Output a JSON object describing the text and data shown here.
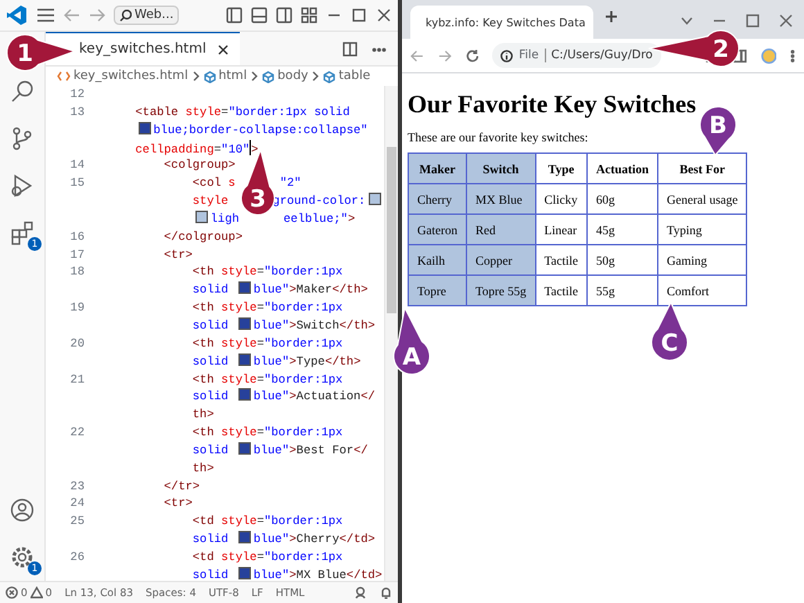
{
  "editor": {
    "title_bar": {
      "search": "Web..."
    },
    "activity_badges": {
      "extensions": "1",
      "settings": "1"
    },
    "tab": {
      "label": "key_switches.html",
      "selected": true
    },
    "breadcrumb": [
      {
        "kind": "file",
        "label": "key_switches.html"
      },
      {
        "kind": "element",
        "label": "html"
      },
      {
        "kind": "element",
        "label": "body"
      },
      {
        "kind": "element",
        "label": "table"
      }
    ],
    "code_lines": [
      {
        "number": "12"
      },
      {
        "number": "13",
        "rows": [
          [
            {
              "kind": "tag",
              "text": "<table"
            },
            {
              "kind": "attr",
              "text": " style"
            },
            {
              "kind": "text",
              "text": "="
            },
            {
              "kind": "string",
              "text": "\"border:1px solid"
            }
          ],
          [
            {
              "kind": "swatch",
              "color": "#27419b"
            },
            {
              "kind": "string",
              "text": "blue;border-collapse:collapse\""
            }
          ],
          [
            {
              "kind": "attr",
              "text": "cellpadding"
            },
            {
              "kind": "text",
              "text": "="
            },
            {
              "kind": "string",
              "text": "\"10\""
            },
            {
              "kind": "cursor"
            },
            {
              "kind": "tag",
              "text": ">"
            }
          ]
        ],
        "children": [
          {
            "number": "14",
            "rows": [
              [
                {
                  "kind": "tag",
                  "text": "<colgroup>"
                }
              ]
            ],
            "children": [
              {
                "number": "15",
                "rows": [
                  [
                    {
                      "kind": "tag",
                      "text": "<col"
                    },
                    {
                      "kind": "attr",
                      "text": " s"
                    },
                    {
                      "kind": "covered"
                    },
                    {
                      "kind": "string",
                      "text": "\"2\""
                    }
                  ],
                  [
                    {
                      "kind": "attr",
                      "text": "style"
                    },
                    {
                      "kind": "covered"
                    },
                    {
                      "kind": "string",
                      "text": "ground-color:"
                    },
                    {
                      "kind": "swatch",
                      "color": "#b0c4de"
                    }
                  ],
                  [
                    {
                      "kind": "swatch",
                      "color": "#b0c4de"
                    },
                    {
                      "kind": "string",
                      "text": "ligh"
                    },
                    {
                      "kind": "covered"
                    },
                    {
                      "kind": "string",
                      "text": "eelblue;\""
                    },
                    {
                      "kind": "tag",
                      "text": ">"
                    }
                  ]
                ]
              }
            ]
          },
          {
            "number": "16",
            "rows": [
              [
                {
                  "kind": "tag",
                  "text": "</colgroup>"
                }
              ]
            ]
          },
          {
            "number": "17",
            "rows": [
              [
                {
                  "kind": "tag",
                  "text": "<tr>"
                }
              ]
            ],
            "children": [
              {
                "number": "18",
                "rows": [
                  [
                    {
                      "kind": "tag",
                      "text": "<th"
                    },
                    {
                      "kind": "attr",
                      "text": " style"
                    },
                    {
                      "kind": "text",
                      "text": "="
                    },
                    {
                      "kind": "string",
                      "text": "\"border:1px"
                    }
                  ],
                  [
                    {
                      "kind": "string",
                      "text": "solid "
                    },
                    {
                      "kind": "swatch",
                      "color": "#27419b"
                    },
                    {
                      "kind": "string",
                      "text": "blue\""
                    },
                    {
                      "kind": "tag",
                      "text": ">"
                    },
                    {
                      "kind": "text",
                      "text": "Maker"
                    },
                    {
                      "kind": "tag",
                      "text": "</th>"
                    }
                  ]
                ]
              },
              {
                "number": "19",
                "rows": [
                  [
                    {
                      "kind": "tag",
                      "text": "<th"
                    },
                    {
                      "kind": "attr",
                      "text": " style"
                    },
                    {
                      "kind": "text",
                      "text": "="
                    },
                    {
                      "kind": "string",
                      "text": "\"border:1px"
                    }
                  ],
                  [
                    {
                      "kind": "string",
                      "text": "solid "
                    },
                    {
                      "kind": "swatch",
                      "color": "#27419b"
                    },
                    {
                      "kind": "string",
                      "text": "blue\""
                    },
                    {
                      "kind": "tag",
                      "text": ">"
                    },
                    {
                      "kind": "text",
                      "text": "Switch"
                    },
                    {
                      "kind": "tag",
                      "text": "</th>"
                    }
                  ]
                ]
              },
              {
                "number": "20",
                "rows": [
                  [
                    {
                      "kind": "tag",
                      "text": "<th"
                    },
                    {
                      "kind": "attr",
                      "text": " style"
                    },
                    {
                      "kind": "text",
                      "text": "="
                    },
                    {
                      "kind": "string",
                      "text": "\"border:1px"
                    }
                  ],
                  [
                    {
                      "kind": "string",
                      "text": "solid "
                    },
                    {
                      "kind": "swatch",
                      "color": "#27419b"
                    },
                    {
                      "kind": "string",
                      "text": "blue\""
                    },
                    {
                      "kind": "tag",
                      "text": ">"
                    },
                    {
                      "kind": "text",
                      "text": "Type"
                    },
                    {
                      "kind": "tag",
                      "text": "</th>"
                    }
                  ]
                ]
              },
              {
                "number": "21",
                "rows": [
                  [
                    {
                      "kind": "tag",
                      "text": "<th"
                    },
                    {
                      "kind": "attr",
                      "text": " style"
                    },
                    {
                      "kind": "text",
                      "text": "="
                    },
                    {
                      "kind": "string",
                      "text": "\"border:1px"
                    }
                  ],
                  [
                    {
                      "kind": "string",
                      "text": "solid "
                    },
                    {
                      "kind": "swatch",
                      "color": "#27419b"
                    },
                    {
                      "kind": "string",
                      "text": "blue\""
                    },
                    {
                      "kind": "tag",
                      "text": ">"
                    },
                    {
                      "kind": "text",
                      "text": "Actuation"
                    },
                    {
                      "kind": "tag",
                      "text": "</"
                    }
                  ],
                  [
                    {
                      "kind": "tag",
                      "text": "th>"
                    }
                  ]
                ]
              },
              {
                "number": "22",
                "rows": [
                  [
                    {
                      "kind": "tag",
                      "text": "<th"
                    },
                    {
                      "kind": "attr",
                      "text": " style"
                    },
                    {
                      "kind": "text",
                      "text": "="
                    },
                    {
                      "kind": "string",
                      "text": "\"border:1px"
                    }
                  ],
                  [
                    {
                      "kind": "string",
                      "text": "solid "
                    },
                    {
                      "kind": "swatch",
                      "color": "#27419b"
                    },
                    {
                      "kind": "string",
                      "text": "blue\""
                    },
                    {
                      "kind": "tag",
                      "text": ">"
                    },
                    {
                      "kind": "text",
                      "text": "Best For"
                    },
                    {
                      "kind": "tag",
                      "text": "</"
                    }
                  ],
                  [
                    {
                      "kind": "tag",
                      "text": "th>"
                    }
                  ]
                ]
              }
            ]
          },
          {
            "number": "23",
            "rows": [
              [
                {
                  "kind": "tag",
                  "text": "</tr>"
                }
              ]
            ]
          },
          {
            "number": "24",
            "rows": [
              [
                {
                  "kind": "tag",
                  "text": "<tr>"
                }
              ]
            ],
            "children": [
              {
                "number": "25",
                "rows": [
                  [
                    {
                      "kind": "tag",
                      "text": "<td"
                    },
                    {
                      "kind": "attr",
                      "text": " style"
                    },
                    {
                      "kind": "text",
                      "text": "="
                    },
                    {
                      "kind": "string",
                      "text": "\"border:1px"
                    }
                  ],
                  [
                    {
                      "kind": "string",
                      "text": "solid "
                    },
                    {
                      "kind": "swatch",
                      "color": "#27419b"
                    },
                    {
                      "kind": "string",
                      "text": "blue\""
                    },
                    {
                      "kind": "tag",
                      "text": ">"
                    },
                    {
                      "kind": "text",
                      "text": "Cherry"
                    },
                    {
                      "kind": "tag",
                      "text": "</td>"
                    }
                  ]
                ]
              },
              {
                "number": "26",
                "rows": [
                  [
                    {
                      "kind": "tag",
                      "text": "<td"
                    },
                    {
                      "kind": "attr",
                      "text": " style"
                    },
                    {
                      "kind": "text",
                      "text": "="
                    },
                    {
                      "kind": "string",
                      "text": "\"border:1px"
                    }
                  ],
                  [
                    {
                      "kind": "string",
                      "text": "solid "
                    },
                    {
                      "kind": "swatch",
                      "color": "#27419b"
                    },
                    {
                      "kind": "string",
                      "text": "blue\""
                    },
                    {
                      "kind": "tag",
                      "text": ">"
                    },
                    {
                      "kind": "text",
                      "text": "MX Blue"
                    },
                    {
                      "kind": "tag",
                      "text": "</td>"
                    }
                  ]
                ]
              }
            ]
          }
        ]
      }
    ],
    "status_bar": {
      "errors": "0",
      "warnings": "0",
      "items": [
        "Ln 13, Col 83",
        "Spaces: 4",
        "UTF-8",
        "LF",
        "HTML"
      ]
    }
  },
  "browser": {
    "tab": {
      "title": "kybz.info: Key Switches Data",
      "selected": true
    },
    "address": {
      "scheme": "File",
      "path": "C:/Users/Guy/Dro"
    },
    "page": {
      "heading": "Our Favorite Key Switches",
      "intro": "These are our favorite key switches:",
      "table": {
        "columns": [
          {
            "label": "Maker",
            "shaded": true
          },
          {
            "label": "Switch",
            "shaded": true
          },
          {
            "label": "Type",
            "shaded": false
          },
          {
            "label": "Actuation",
            "shaded": false
          },
          {
            "label": "Best For",
            "shaded": false
          }
        ],
        "rows": [
          [
            "Cherry",
            "MX Blue",
            "Clicky",
            "60g",
            "General usage"
          ],
          [
            "Gateron",
            "Red",
            "Linear",
            "45g",
            "Typing"
          ],
          [
            "Kailh",
            "Copper",
            "Tactile",
            "50g",
            "Gaming"
          ],
          [
            "Topre",
            "Topre 55g",
            "Tactile",
            "55g",
            "Comfort"
          ]
        ]
      }
    }
  },
  "callouts": [
    {
      "label": "1",
      "color": "#a3173a"
    },
    {
      "label": "2",
      "color": "#a3173a"
    },
    {
      "label": "3",
      "color": "#a3173a"
    },
    {
      "label": "A",
      "color": "#7b3294"
    },
    {
      "label": "B",
      "color": "#7b3294"
    },
    {
      "label": "C",
      "color": "#7b3294"
    }
  ]
}
